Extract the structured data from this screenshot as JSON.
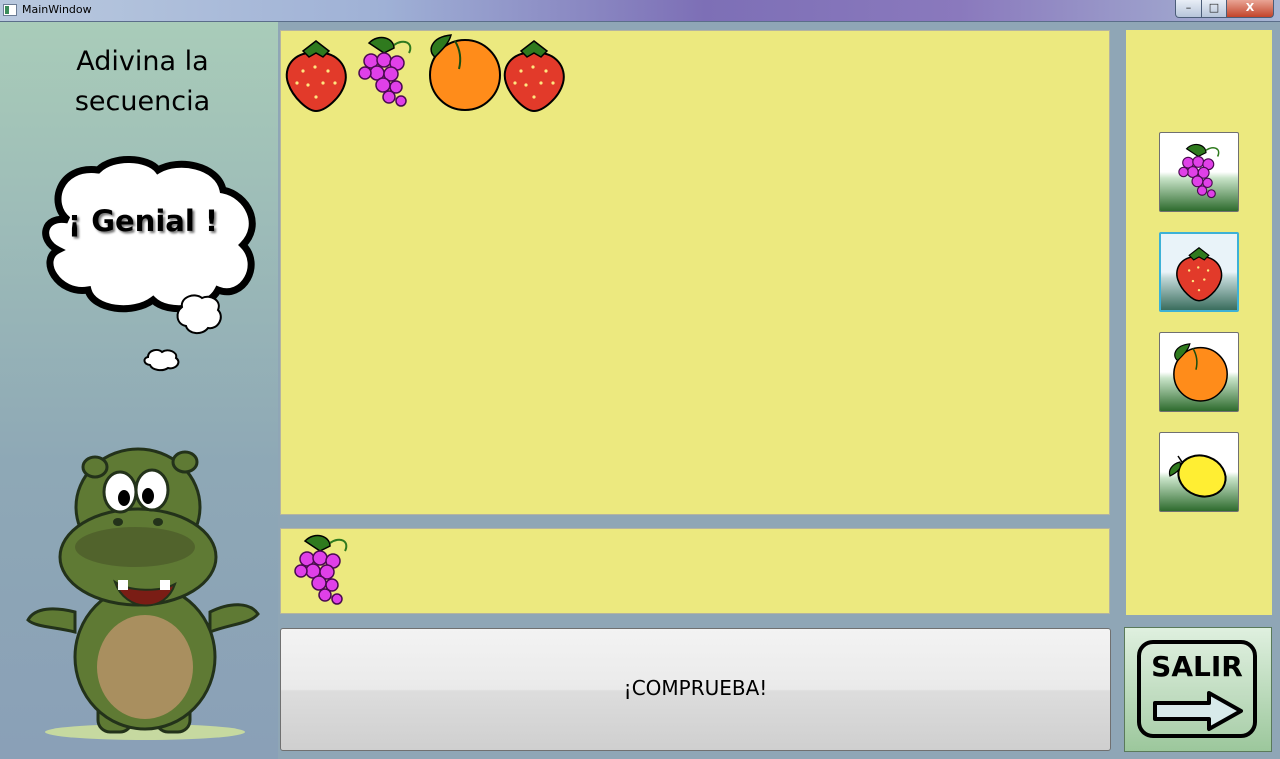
{
  "window": {
    "title": "MainWindow",
    "minimize_glyph": "–",
    "maximize_glyph": "□",
    "close_glyph": "X"
  },
  "left_panel": {
    "heading": "Adivina la secuencia",
    "feedback": "¡ Genial !",
    "mascot": "hippo"
  },
  "sequence_panel": {
    "fruits": [
      "strawberry",
      "grapes",
      "orange",
      "strawberry"
    ]
  },
  "answer_panel": {
    "fruits": [
      "grapes"
    ]
  },
  "palette": {
    "options": [
      {
        "fruit": "grapes",
        "selected": false
      },
      {
        "fruit": "strawberry",
        "selected": true
      },
      {
        "fruit": "orange",
        "selected": false
      },
      {
        "fruit": "lemon",
        "selected": false
      }
    ]
  },
  "buttons": {
    "check_label": "¡COMPRUEBA!",
    "exit_label": "SALIR"
  },
  "colors": {
    "panel_bg": "#ece97f",
    "strawberry": "#e23a2a",
    "grapes": "#e040e8",
    "orange": "#ff8c1a",
    "lemon": "#ffee33",
    "leaf": "#2f7a1e"
  }
}
